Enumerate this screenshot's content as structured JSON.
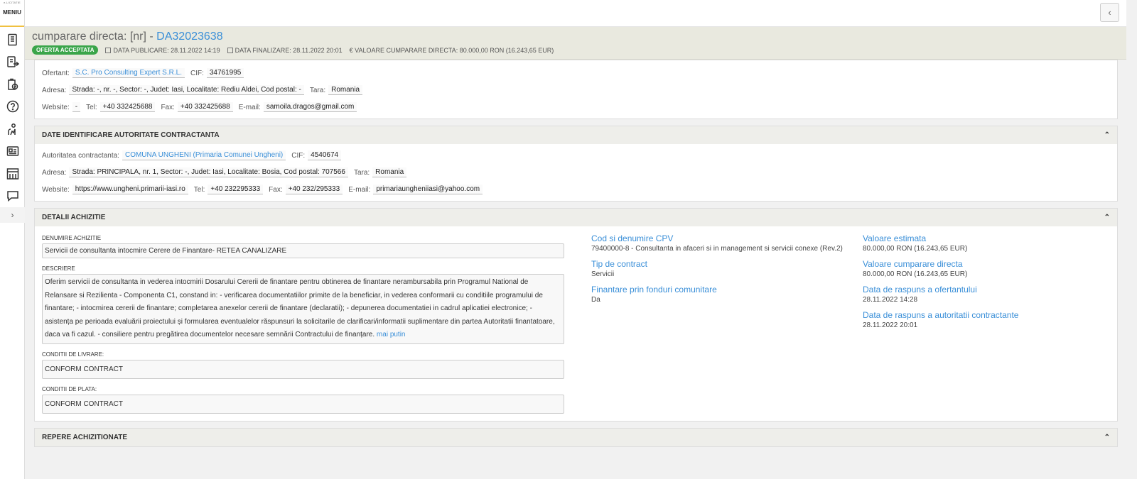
{
  "rail": {
    "brand_small": "e-LICITATIE",
    "menu_label": "MENIU",
    "icons": [
      "document-icon",
      "export-icon",
      "clipboard-check-icon",
      "help-icon",
      "person-tree-icon",
      "id-card-icon",
      "building-icon",
      "chat-icon"
    ],
    "expand_label": "›"
  },
  "topbar": {
    "back_label": "‹"
  },
  "header": {
    "title_prefix": "cumparare directa: [nr] - ",
    "code": "DA32023638",
    "badge": "OFERTA ACCEPTATA",
    "publish": "DATA PUBLICARE: 28.11.2022 14:19",
    "finalize": "DATA FINALIZARE: 28.11.2022 20:01",
    "value": "€ VALOARE CUMPARARE DIRECTA: 80.000,00  RON (16.243,65  EUR)",
    "colors": {
      "badge": "#3aa54a",
      "accent": "#3a8fd8"
    }
  },
  "ofertant": {
    "ofertant_label": "Ofertant:",
    "ofertant_value": "S.C. Pro Consulting Expert S.R.L.",
    "cif_label": "CIF:",
    "cif_value": "34761995",
    "adresa_label": "Adresa:",
    "adresa_value": "Strada: -, nr. -, Sector: -, Judet: Iasi, Localitate: Rediu Aldei, Cod postal: -",
    "tara_label": "Tara:",
    "tara_value": "Romania",
    "website_label": "Website:",
    "website_value": "-",
    "tel_label": "Tel:",
    "tel_value": "+40 332425688",
    "fax_label": "Fax:",
    "fax_value": "+40 332425688",
    "email_label": "E-mail:",
    "email_value": "samoila.dragos@gmail.com"
  },
  "autoritate": {
    "heading": "DATE IDENTIFICARE AUTORITATE CONTRACTANTA",
    "aut_label": "Autoritatea contractanta:",
    "aut_value": "COMUNA UNGHENI (Primaria Comunei Ungheni)",
    "cif_label": "CIF:",
    "cif_value": "4540674",
    "adresa_label": "Adresa:",
    "adresa_value": "Strada: PRINCIPALA, nr. 1, Sector: -, Judet: Iasi, Localitate: Bosia, Cod postal: 707566",
    "tara_label": "Tara:",
    "tara_value": "Romania",
    "website_label": "Website:",
    "website_value": "https://www.ungheni.primarii-iasi.ro",
    "tel_label": "Tel:",
    "tel_value": "+40 232295333",
    "fax_label": "Fax:",
    "fax_value": "+40 232/295333",
    "email_label": "E-mail:",
    "email_value": "primariaungheniiasi@yahoo.com"
  },
  "detalii": {
    "heading": "DETALII ACHIZITIE",
    "denumire_label": "DENUMIRE ACHIZITIE",
    "denumire_value": "Servicii de consultanta intocmire Cerere de Finantare- RETEA CANALIZARE",
    "descriere_label": "DESCRIERE",
    "descriere_value": "Oferim servicii de consultanta in vederea intocmirii Dosarului Cererii de finantare pentru obtinerea de finantare nerambursabila prin Programul National de Relansare si Rezilienta - Componenta C1, constand in: - verificarea documentatiilor primite de la beneficiar, in vederea conformarii cu conditiile programului de finantare; - intocmirea cererii de finantare; completarea anexelor cererii de finantare (declaratii); - depunerea documentatiei in cadrul aplicatiei electronice; - asistența pe perioada evaluării proiectului și formularea eventualelor răspunsuri la solicitarile de clarificari/informatii suplimentare din partea Autoritatii finantatoare, daca va fi cazul. - consiliere pentru pregătirea documentelor necesare semnării Contractului de finanțare.",
    "mai_putin": "mai putin",
    "livrare_label": "CONDITII DE LIVRARE:",
    "livrare_value": "CONFORM CONTRACT",
    "plata_label": "CONDITII DE PLATA:",
    "plata_value": "CONFORM CONTRACT",
    "cpv_title": "Cod si denumire CPV",
    "cpv_value": "79400000-8 - Consultanta in afaceri si in management si servicii conexe (Rev.2)",
    "tip_title": "Tip de contract",
    "tip_value": "Servicii",
    "fonduri_title": "Finantare prin fonduri comunitare",
    "fonduri_value": "Da",
    "val_est_title": "Valoare estimata",
    "val_est_value": "80.000,00  RON (16.243,65  EUR)",
    "val_cump_title": "Valoare cumparare directa",
    "val_cump_value": "80.000,00  RON (16.243,65  EUR)",
    "raspuns_of_title": "Data de raspuns a ofertantului",
    "raspuns_of_value": "28.11.2022 14:28",
    "raspuns_aut_title": "Data de raspuns a autoritatii contractante",
    "raspuns_aut_value": "28.11.2022 20:01"
  },
  "repere": {
    "heading": "REPERE ACHIZITIONATE"
  }
}
